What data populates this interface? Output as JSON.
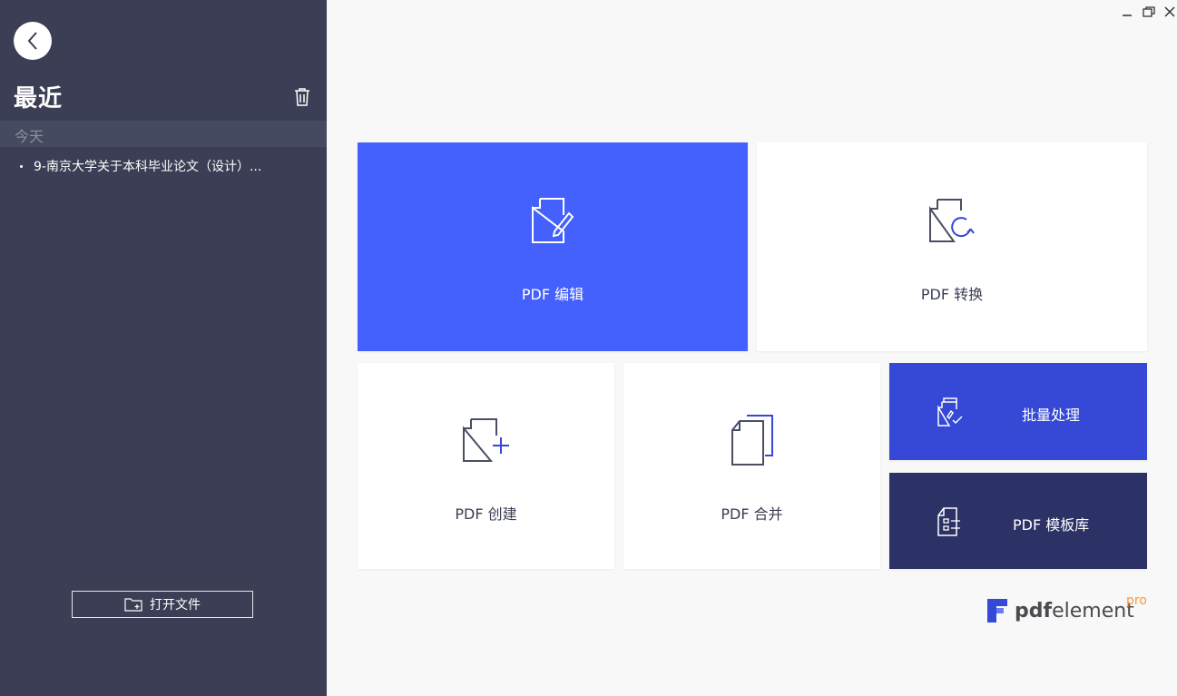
{
  "sidebar": {
    "title": "最近",
    "section": "今天",
    "recent_files": [
      {
        "name": "9-南京大学关于本科毕业论文（设计）..."
      }
    ],
    "open_file_label": "打开文件"
  },
  "tiles": {
    "edit": {
      "label": "PDF 编辑",
      "icon": "edit-document-icon"
    },
    "convert": {
      "label": "PDF 转换",
      "icon": "convert-document-icon"
    },
    "create": {
      "label": "PDF 创建",
      "icon": "create-document-icon"
    },
    "merge": {
      "label": "PDF 合并",
      "icon": "merge-documents-icon"
    },
    "batch": {
      "label": "批量处理",
      "icon": "batch-process-icon"
    },
    "template": {
      "label": "PDF 模板库",
      "icon": "template-library-icon"
    }
  },
  "logo": {
    "bold": "pdf",
    "rest": "element",
    "pro": "pro"
  },
  "colors": {
    "sidebar_bg": "#3b3e54",
    "edit_tile": "#4461fd",
    "batch_tile": "#3548d6",
    "template_tile": "#2c3266",
    "accent_orange": "#f59b3d"
  }
}
